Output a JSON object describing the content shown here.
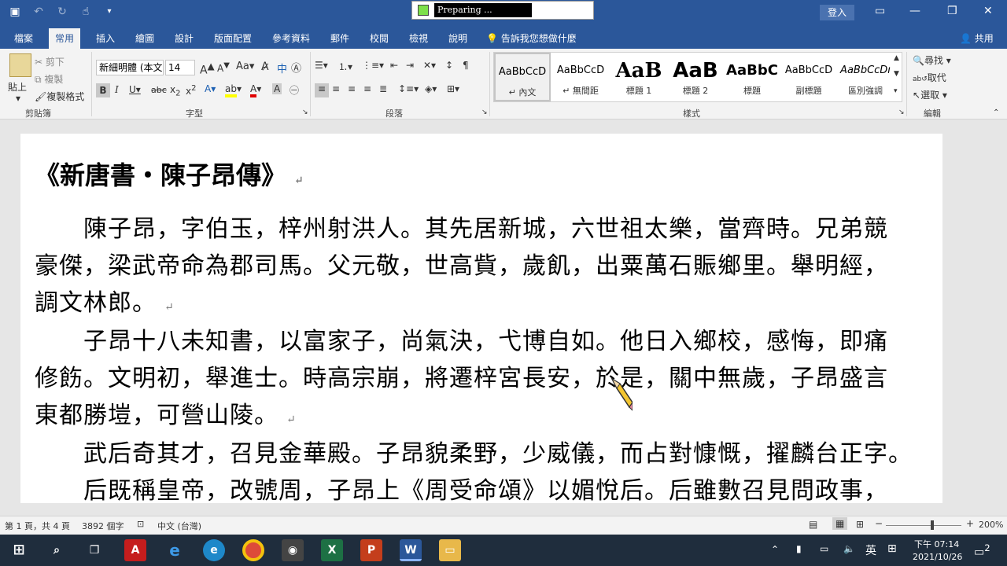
{
  "titlebar": {
    "status_text": "Preparing ...",
    "signin_label": "登入",
    "minimize": "—",
    "restore": "❐",
    "close": "✕"
  },
  "ribbon_tabs": {
    "file": "檔案",
    "home": "常用",
    "insert": "插入",
    "draw": "繪圖",
    "design": "設計",
    "layout": "版面配置",
    "references": "參考資料",
    "mailings": "郵件",
    "review": "校閱",
    "view": "檢視",
    "help": "說明",
    "tell_me": "告訴我您想做什麼",
    "share": "共用"
  },
  "clipboard": {
    "paste": "貼上",
    "cut": "剪下",
    "copy": "複製",
    "format_painter": "複製格式",
    "group": "剪貼簿"
  },
  "font": {
    "name": "新細明體 (本文",
    "size": "14",
    "group": "字型"
  },
  "paragraph": {
    "group": "段落"
  },
  "styles": {
    "group": "樣式",
    "items": [
      {
        "sample": "AaBbCcD",
        "name": "↵ 內文"
      },
      {
        "sample": "AaBbCcD",
        "name": "↵ 無間距"
      },
      {
        "sample": "AaB",
        "name": "標題 1"
      },
      {
        "sample": "AaB",
        "name": "標題 2"
      },
      {
        "sample": "AaBbC",
        "name": "標題"
      },
      {
        "sample": "AaBbCcD",
        "name": "副標題"
      },
      {
        "sample": "AaBbCcDı",
        "name": "區別強調"
      }
    ]
  },
  "editing": {
    "find": "尋找",
    "replace": "取代",
    "select": "選取",
    "group": "編輯"
  },
  "document": {
    "title": "《新唐書・陳子昂傳》",
    "p1_line1": "陳子昂，字伯玉，梓州射洪人。其先居新城，六世祖太樂，當齊時。兄弟競",
    "p1_line2": "豪傑，梁武帝命為郡司馬。父元敬，世高貲，歲飢，出粟萬石賑鄉里。舉明經，",
    "p1_line3": "調文林郎。",
    "p2_line1": "子昂十八未知書，以富家子，尚氣決，弋博自如。他日入鄉校，感悔，即痛",
    "p2_line2": "修飭。文明初，舉進士。時高宗崩，將遷梓宮長安，於是，關中無歲，子昂盛言",
    "p2_line3": "東都勝塏，可營山陵。",
    "p3_line1": "武后奇其才，召見金華殿。子昂貌柔野，少威儀，而占對慷慨，擢麟台正字。",
    "p3_line2": "后既稱皇帝，改號周，子昂上《周受命頌》以媚悅后。后雖數召見問政事，"
  },
  "statusbar": {
    "page": "第 1 頁，共 4 頁",
    "words": "3892 個字",
    "language": "中文 (台灣)",
    "zoom": "200%"
  },
  "taskbar": {
    "ime": "英",
    "time": "下午 07:14",
    "date": "2021/10/26",
    "notifications": "2"
  }
}
